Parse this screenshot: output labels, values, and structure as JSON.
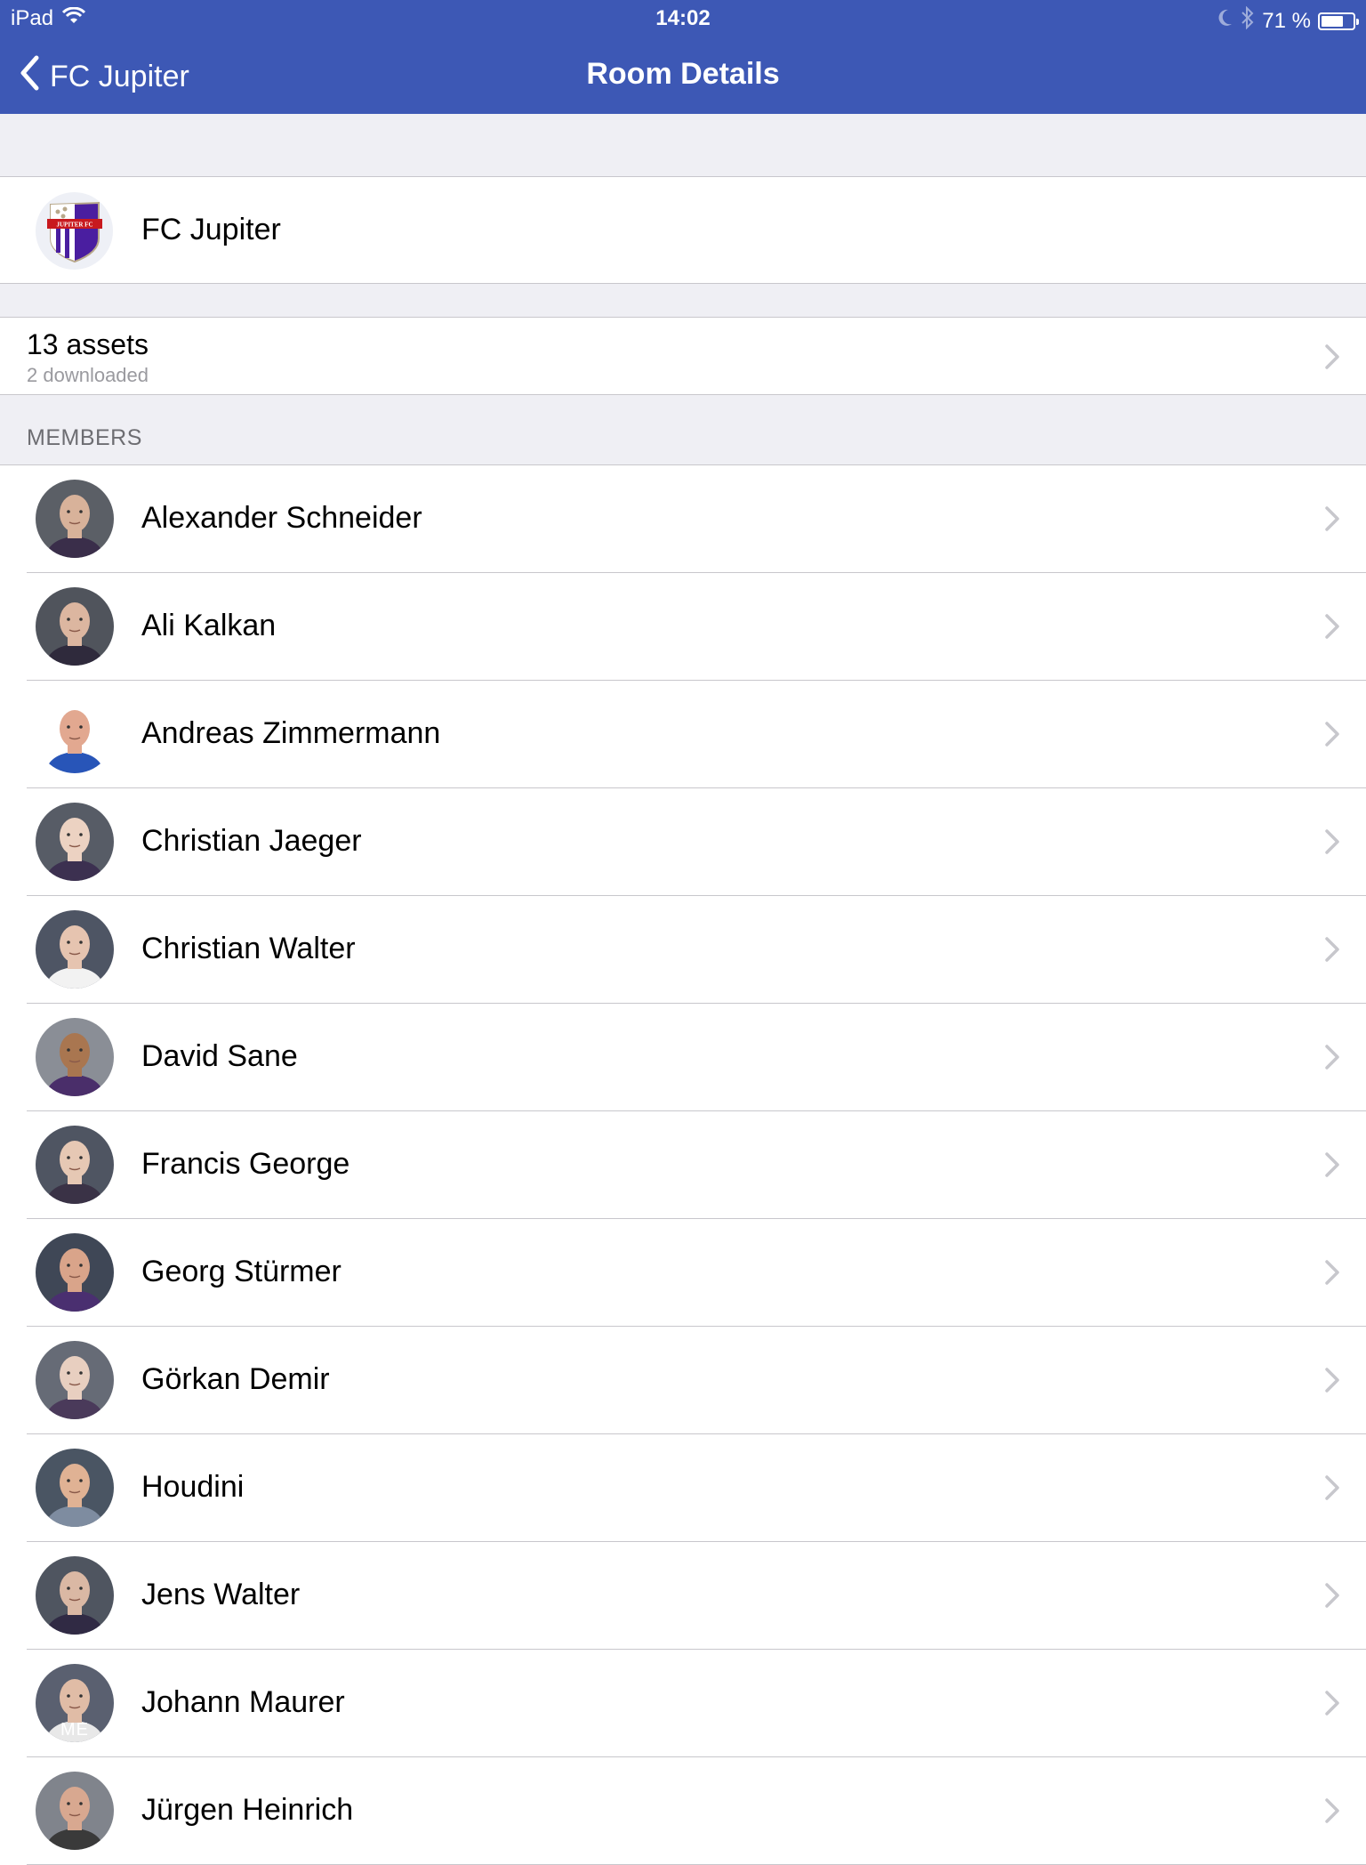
{
  "status_bar": {
    "device": "iPad",
    "time": "14:02",
    "battery_percent_label": "71 %",
    "battery_level": 0.71,
    "icons": [
      "wifi-icon",
      "moon-icon",
      "bluetooth-icon",
      "battery-icon"
    ]
  },
  "nav": {
    "back_label": "FC Jupiter",
    "title": "Room Details"
  },
  "club": {
    "name": "FC Jupiter",
    "logo_text": "JUPITER FC"
  },
  "assets": {
    "title": "13 assets",
    "subtitle": "2 downloaded"
  },
  "members_section": {
    "header": "MEMBERS",
    "items": [
      {
        "name": "Alexander Schneider",
        "bg": "#5b5f66",
        "skin": "#d8b29a",
        "shirt": "#3a2e4a"
      },
      {
        "name": "Ali Kalkan",
        "bg": "#50545c",
        "skin": "#dcb6a0",
        "shirt": "#2f2a3c"
      },
      {
        "name": "Andreas Zimmermann",
        "bg": "#ffffff",
        "skin": "#e2a890",
        "shirt": "#2855b8"
      },
      {
        "name": "Christian Jaeger",
        "bg": "#575c66",
        "skin": "#ecd2c2",
        "shirt": "#3c3050"
      },
      {
        "name": "Christian Walter",
        "bg": "#4e5564",
        "skin": "#e6c4b0",
        "shirt": "#f2f2f2"
      },
      {
        "name": "David Sane",
        "bg": "#8a8e96",
        "skin": "#a97650",
        "shirt": "#4a2e6a"
      },
      {
        "name": "Francis George",
        "bg": "#4f5562",
        "skin": "#e6c8b4",
        "shirt": "#3a3246"
      },
      {
        "name": "Georg Stürmer",
        "bg": "#3f4756",
        "skin": "#d9a48a",
        "shirt": "#4a2f70"
      },
      {
        "name": "Görkan Demir",
        "bg": "#666b76",
        "skin": "#e8cfc0",
        "shirt": "#4a3a5a"
      },
      {
        "name": "Houdini",
        "bg": "#4a5563",
        "skin": "#e0b294",
        "shirt": "#7e8ca0"
      },
      {
        "name": "Jens Walter",
        "bg": "#4f5560",
        "skin": "#dab8a4",
        "shirt": "#302a44"
      },
      {
        "name": "Johann Maurer",
        "bg": "#5a6070",
        "skin": "#e0bca6",
        "shirt": "#e8e8e8",
        "badge": "ME"
      },
      {
        "name": "Jürgen Heinrich",
        "bg": "#80848c",
        "skin": "#d8a890",
        "shirt": "#3a3a3a"
      }
    ]
  },
  "colors": {
    "nav_background": "#3d58b5",
    "grouped_background": "#efeff4",
    "separator": "#c8c7cc",
    "chevron": "#c7c7cc",
    "secondary_text": "#9a9a9f",
    "section_header_text": "#6d6d72"
  }
}
